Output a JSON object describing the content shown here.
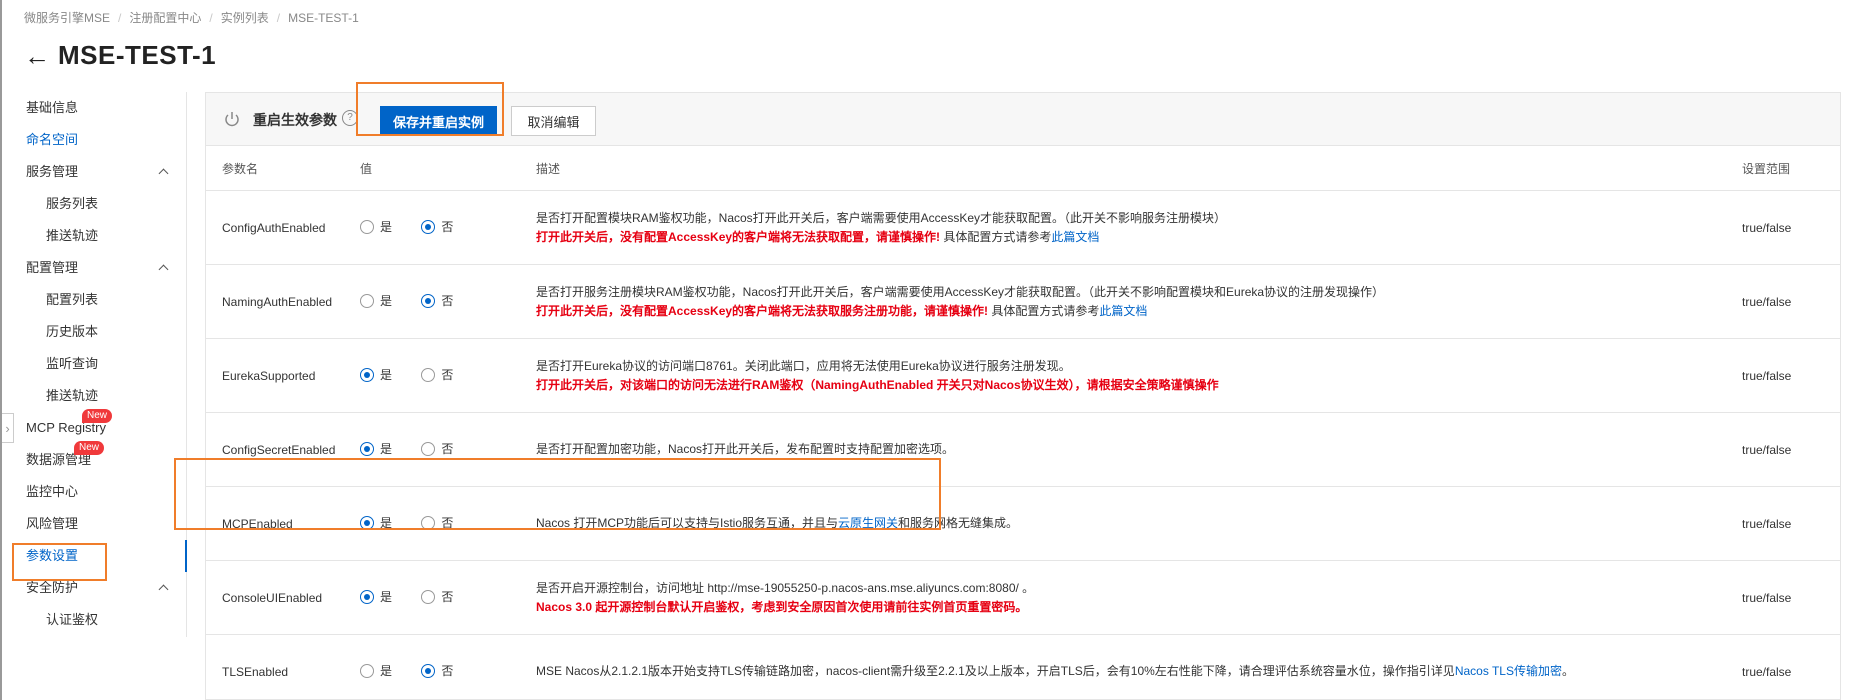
{
  "breadcrumb": [
    "微服务引擎MSE",
    "注册配置中心",
    "实例列表",
    "MSE-TEST-1"
  ],
  "page_title": "MSE-TEST-1",
  "sidebar": {
    "basic_info": "基础信息",
    "namespace": "命名空间",
    "service_mgmt": "服务管理",
    "service_list": "服务列表",
    "push_trace_1": "推送轨迹",
    "config_mgmt": "配置管理",
    "config_list": "配置列表",
    "history": "历史版本",
    "listen_query": "监听查询",
    "push_trace_2": "推送轨迹",
    "mcp_registry": "MCP Registry",
    "datasource_mgmt": "数据源管理",
    "new_badge": "New",
    "monitor": "监控中心",
    "risk_mgmt": "风险管理",
    "param_settings": "参数设置",
    "security": "安全防护",
    "auth": "认证鉴权"
  },
  "toolbar": {
    "title": "重启生效参数",
    "help": "?",
    "save_restart": "保存并重启实例",
    "cancel_edit": "取消编辑"
  },
  "table": {
    "headers": {
      "name": "参数名",
      "value": "值",
      "desc": "描述",
      "range": "设置范围"
    },
    "yes": "是",
    "no": "否",
    "rows": [
      {
        "name": "ConfigAuthEnabled",
        "value": "否",
        "desc1": "是否打开配置模块RAM鉴权功能，Nacos打开此开关后，客户端需要使用AccessKey才能获取配置。（此开关不影响服务注册模块）",
        "warn": "打开此开关后，没有配置AccessKey的客户端将无法获取配置，请谨慎操作!",
        "desc_tail": " 具体配置方式请参考",
        "link": "此篇文档",
        "range": "true/false"
      },
      {
        "name": "NamingAuthEnabled",
        "value": "否",
        "desc1": "是否打开服务注册模块RAM鉴权功能，Nacos打开此开关后，客户端需要使用AccessKey才能获取配置。（此开关不影响配置模块和Eureka协议的注册发现操作）",
        "warn": "打开此开关后，没有配置AccessKey的客户端将无法获取服务注册功能，请谨慎操作!",
        "desc_tail": " 具体配置方式请参考",
        "link": "此篇文档",
        "range": "true/false"
      },
      {
        "name": "EurekaSupported",
        "value": "是",
        "desc1": "是否打开Eureka协议的访问端口8761。关闭此端口，应用将无法使用Eureka协议进行服务注册发现。",
        "warn": "打开此开关后，对该端口的访问无法进行RAM鉴权（NamingAuthEnabled 开关只对Nacos协议生效），请根据安全策略谨慎操作",
        "range": "true/false"
      },
      {
        "name": "ConfigSecretEnabled",
        "value": "是",
        "desc1": "是否打开配置加密功能，Nacos打开此开关后，发布配置时支持配置加密选项。",
        "range": "true/false"
      },
      {
        "name": "MCPEnabled",
        "value": "是",
        "desc1": "Nacos 打开MCP功能后可以支持与Istio服务互通，并且与",
        "link": "云原生网关",
        "desc_after": "和服务网格无缝集成。",
        "range": "true/false"
      },
      {
        "name": "ConsoleUIEnabled",
        "value": "是",
        "desc1": "是否开启开源控制台，访问地址 http://mse-19055250-p.nacos-ans.mse.aliyuncs.com:8080/ 。",
        "warn": "Nacos 3.0 起开源控制台默认开启鉴权，考虑到安全原因首次使用请前往实例首页重置密码。",
        "range": "true/false"
      },
      {
        "name": "TLSEnabled",
        "value": "否",
        "desc1": "MSE Nacos从2.1.2.1版本开始支持TLS传输链路加密，nacos-client需升级至2.2.1及以上版本，开启TLS后，会有10%左右性能下降，请合理评估系统容量水位，操作指引详见",
        "link": "Nacos TLS传输加密",
        "desc_after": "。",
        "range": "true/false"
      }
    ]
  },
  "colors": {
    "primary": "#0064c8",
    "warning": "#e60012",
    "highlight": "#f07d2a",
    "badge": "#f0393b"
  }
}
